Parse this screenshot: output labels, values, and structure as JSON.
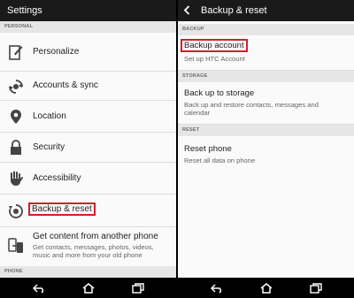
{
  "left_pane": {
    "title": "Settings",
    "section_personal": "PERSONAL",
    "section_phone": "PHONE",
    "items": [
      {
        "label": "Personalize",
        "icon": "personalize-icon"
      },
      {
        "label": "Accounts & sync",
        "icon": "sync-icon"
      },
      {
        "label": "Location",
        "icon": "location-pin-icon"
      },
      {
        "label": "Security",
        "icon": "lock-icon"
      },
      {
        "label": "Accessibility",
        "icon": "hand-icon"
      },
      {
        "label": "Backup & reset",
        "icon": "backup-icon"
      },
      {
        "label": "Get content from another phone",
        "sub": "Get contacts, messages, photos, videos, music and more from your old phone",
        "icon": "transfer-phone-icon"
      }
    ]
  },
  "right_pane": {
    "title": "Backup & reset",
    "back_icon": "back-chevron-icon",
    "section_backup": "BACKUP",
    "section_storage": "STORAGE",
    "section_reset": "RESET",
    "items": [
      {
        "label": "Backup account",
        "sub": "Set up HTC Account"
      },
      {
        "label": "Back up to storage",
        "sub": "Back up and restore contacts, messages and calendar"
      },
      {
        "label": "Reset phone",
        "sub": "Reset all data on phone"
      }
    ]
  },
  "navbar": {
    "icons": [
      "back-icon",
      "home-icon",
      "recents-icon"
    ]
  },
  "colors": {
    "highlight": "#d0202a",
    "action_bar": "#1a1a1a",
    "section_header": "#e6e6e6"
  }
}
